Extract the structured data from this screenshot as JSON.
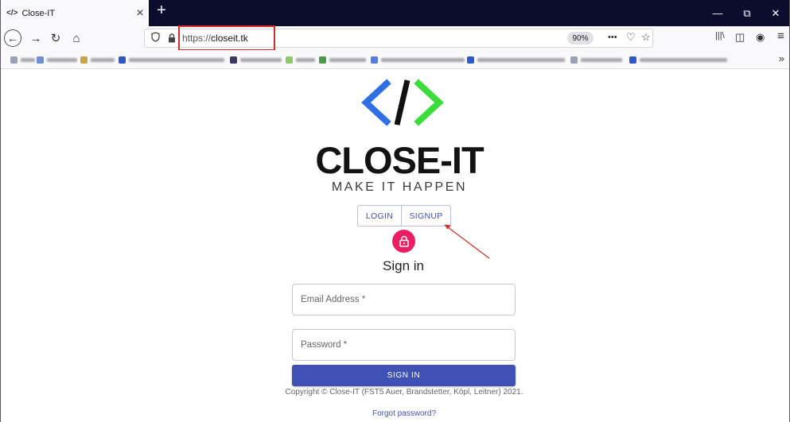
{
  "browser": {
    "tab": {
      "favicon": "</>",
      "title": "Close-IT",
      "close": "×"
    },
    "new_tab": "+",
    "window_controls": {
      "minimize": "—",
      "restore": "⧉",
      "close": "✕"
    },
    "nav": {
      "back": "←",
      "forward": "→",
      "reload": "↻",
      "home": "⌂"
    },
    "address": {
      "prefix": "https://",
      "domain": "closeit.tk",
      "zoom": "90%"
    },
    "url_icons": {
      "more": "•••",
      "pocket": "♡",
      "star": "☆"
    },
    "toolbar_icons": {
      "library": "|||\\",
      "sidebar": "◫",
      "account": "◉",
      "menu": "≡"
    },
    "bookmarks_more": "»",
    "bookmark_colors": [
      "#9aa0b5",
      "#6f8fd1",
      "#c7a648",
      "#2f58c6",
      "#3a3a60",
      "#8fc96b",
      "#4c9a4c",
      "#5b7bd9",
      "#2f58c6",
      "#9aa0b5",
      "#2f58c6"
    ]
  },
  "page": {
    "logo": {
      "left_color": "#2f6fe4",
      "slash_color": "#111111",
      "right_color": "#3ddc3d"
    },
    "brand": "CLOSE-IT",
    "tagline": "MAKE IT HAPPEN",
    "tabs": {
      "login": "LOGIN",
      "signup": "SIGNUP"
    },
    "heading": "Sign in",
    "email_placeholder": "Email Address *",
    "password_placeholder": "Password *",
    "submit": "SIGN IN",
    "copyright": "Copyright © Close-IT (FST5 Auer, Brandstetter, Köpl, Leitner) 2021.",
    "forgot": "Forgot password?"
  },
  "colors": {
    "primary": "#3f51b5",
    "avatar": "#e91e63",
    "annotation": "#d52b2b"
  }
}
